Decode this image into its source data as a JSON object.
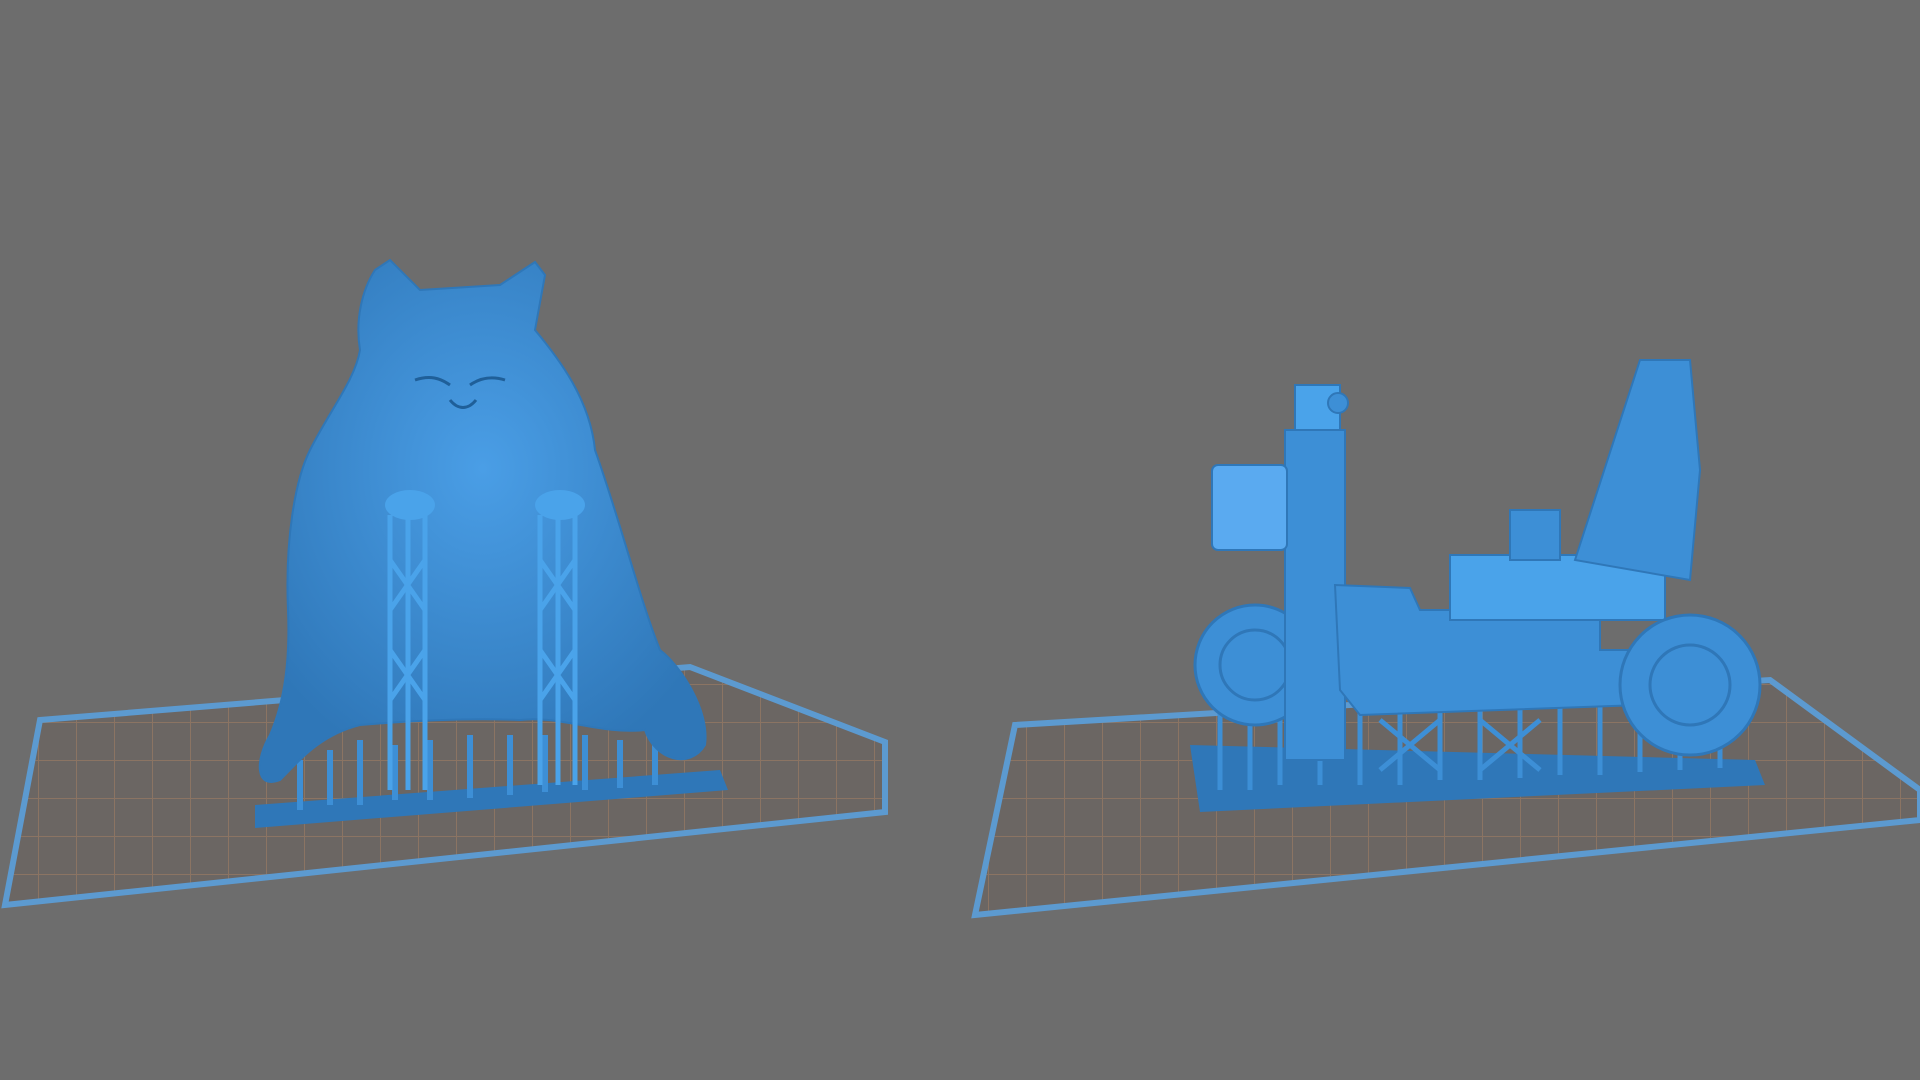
{
  "app": {
    "name": ""
  },
  "viewport": {
    "background_color": "#6d6d6d",
    "model_color": "#3d8fd6",
    "model_shade_color": "#2f77b8",
    "plate_grid_color": "#8b7463",
    "plate_border_color": "#5c9ad0"
  },
  "scenes": [
    {
      "name": "cat-model-scene",
      "object": "cat-figure",
      "has_supports": true
    },
    {
      "name": "mobility-scooter-scene",
      "object": "mobility-scooter",
      "has_supports": true
    }
  ]
}
